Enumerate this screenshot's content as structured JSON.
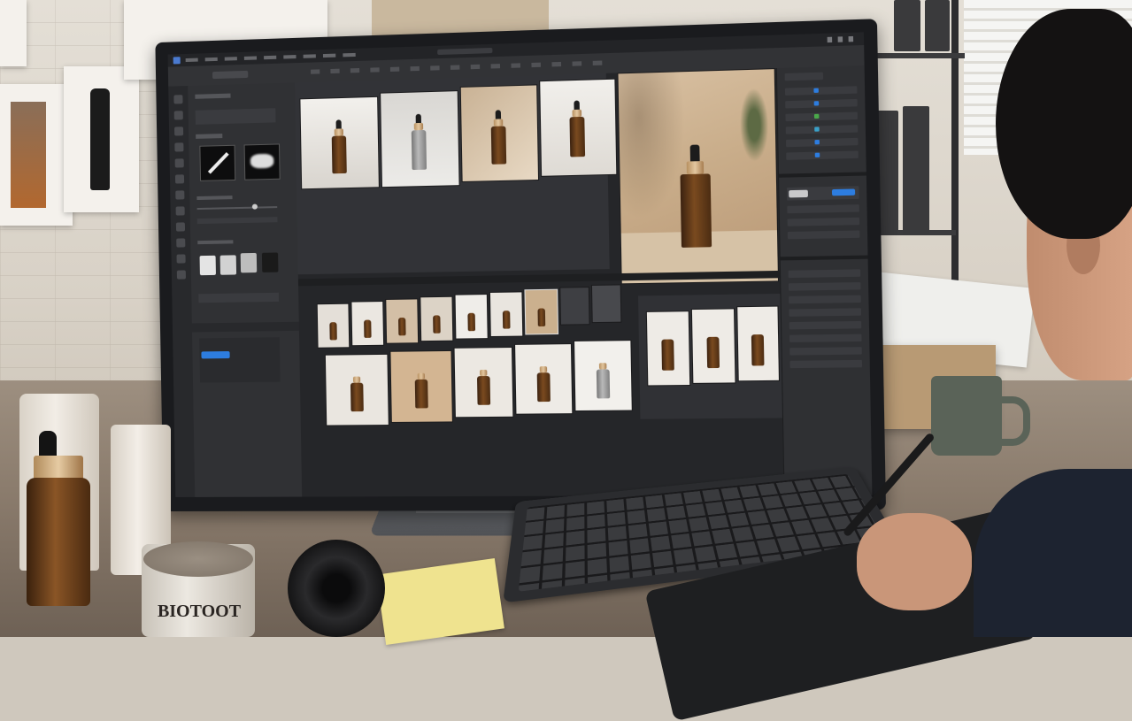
{
  "scene": {
    "description_free": true,
    "photo_editor": {
      "left_panel": {
        "action_button_color": "#2d7de0"
      },
      "right_panel": {
        "layer_dots": [
          "#2d7de0",
          "#2d7de0",
          "#4aa84a",
          "#3aa0c8",
          "#2d7de0",
          "#2d7de0"
        ]
      },
      "accent_color": "#2d7de0"
    },
    "jar_label": "BIOTOOT",
    "colors": {
      "wall": "#e4dfd6",
      "desk": "#9d8f80",
      "monitor_bezel": "#1a1b1e",
      "app_background": "#2b2c2f",
      "sticky_note": "#efe38f",
      "mug": "#5a6358",
      "bottle_amber": "#7a4a1f"
    }
  }
}
